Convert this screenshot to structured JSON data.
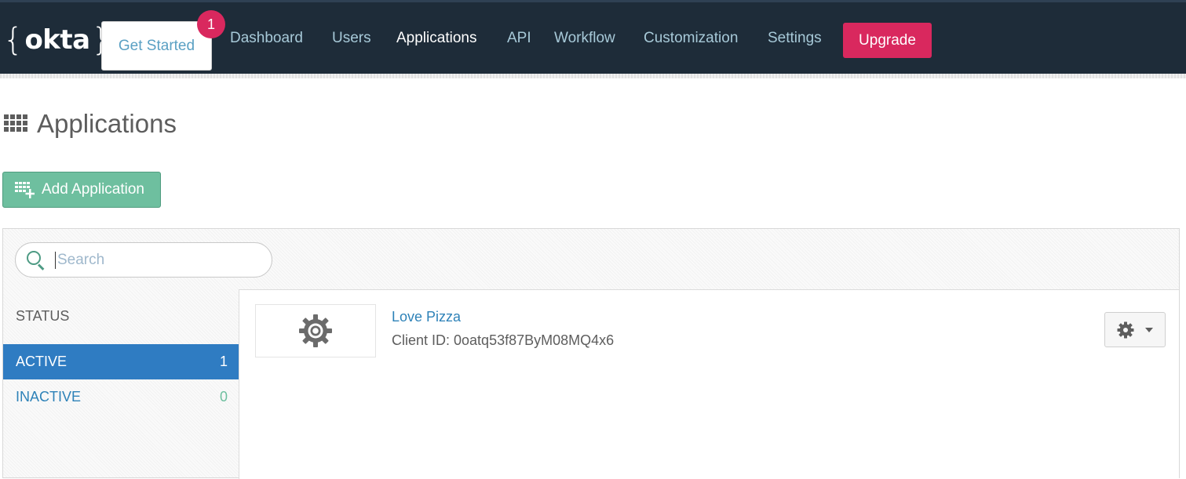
{
  "brand": {
    "name": "okta",
    "brace_open": "{",
    "brace_close": "}"
  },
  "nav": {
    "get_started": "Get Started",
    "get_started_badge": "1",
    "items": [
      {
        "label": "Dashboard",
        "active": false
      },
      {
        "label": "Users",
        "active": false
      },
      {
        "label": "Applications",
        "active": true
      },
      {
        "label": "API",
        "active": false
      },
      {
        "label": "Workflow",
        "active": false
      },
      {
        "label": "Customization",
        "active": false
      },
      {
        "label": "Settings",
        "active": false
      }
    ],
    "upgrade": "Upgrade"
  },
  "page": {
    "title": "Applications",
    "title_icon": "grid-icon",
    "add_button": "Add Application",
    "add_button_icon": "add-app-icon"
  },
  "search": {
    "placeholder": "Search",
    "value": "",
    "icon": "search-icon"
  },
  "filters": {
    "heading": "STATUS",
    "rows": [
      {
        "label": "ACTIVE",
        "count": "1",
        "selected": true
      },
      {
        "label": "INACTIVE",
        "count": "0",
        "selected": false
      }
    ]
  },
  "apps": [
    {
      "name": "Love Pizza",
      "client_id": "Client ID: 0oatq53f87ByM08MQ4x6",
      "logo_icon": "gear-icon",
      "actions_icon": "gear-icon"
    }
  ],
  "colors": {
    "topbar": "#1e2c39",
    "accent_pink": "#d9285e",
    "link_blue": "#2e82b8",
    "selected_blue": "#2f7cc2",
    "green": "#6ebf9f"
  }
}
